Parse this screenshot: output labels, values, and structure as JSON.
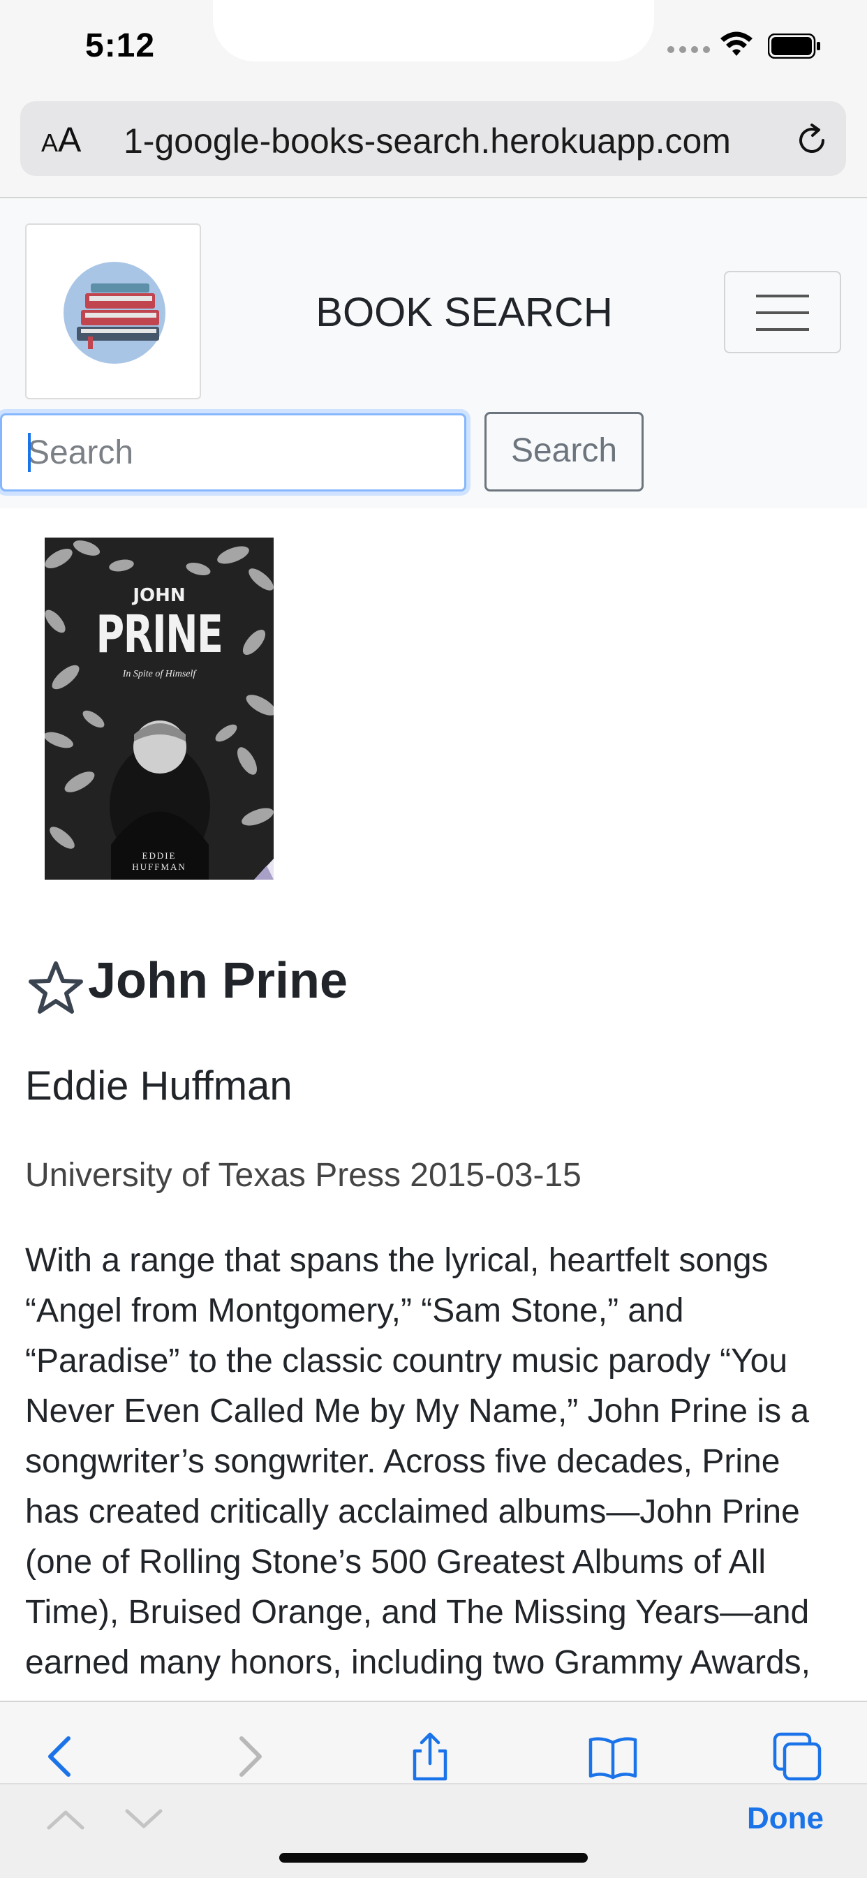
{
  "status_bar": {
    "time": "5:12"
  },
  "browser": {
    "aa_label_small": "A",
    "aa_label_large": "A",
    "url": "1-google-books-search.herokuapp.com"
  },
  "navbar": {
    "brand": "BOOK SEARCH",
    "search_placeholder": "Search",
    "search_button": "Search"
  },
  "book": {
    "cover": {
      "top_name": "JOHN",
      "main_name": "PRINE",
      "subtitle": "In Spite of Himself",
      "author_line1": "EDDIE",
      "author_line2": "HUFFMAN"
    },
    "title": "John Prine",
    "author": "Eddie Huffman",
    "publisher_date": "University of Texas Press 2015-03-15",
    "description": "With a range that spans the lyrical, heartfelt songs “Angel from Montgomery,” “Sam Stone,” and “Paradise” to the classic country music parody “You Never Even Called Me by My Name,” John Prine is a songwriter’s songwriter. Across five decades, Prine has created critically acclaimed albums—John Prine (one of Rolling Stone’s 500 Greatest Albums of All Time), Bruised Orange, and The Missing Years—and earned many honors, including two Grammy Awards,"
  },
  "toolbar": {
    "done": "Done"
  },
  "colors": {
    "accent": "#1a73e8",
    "focus_ring": "#86b7fe",
    "navbar_bg": "#f8f9fa"
  }
}
